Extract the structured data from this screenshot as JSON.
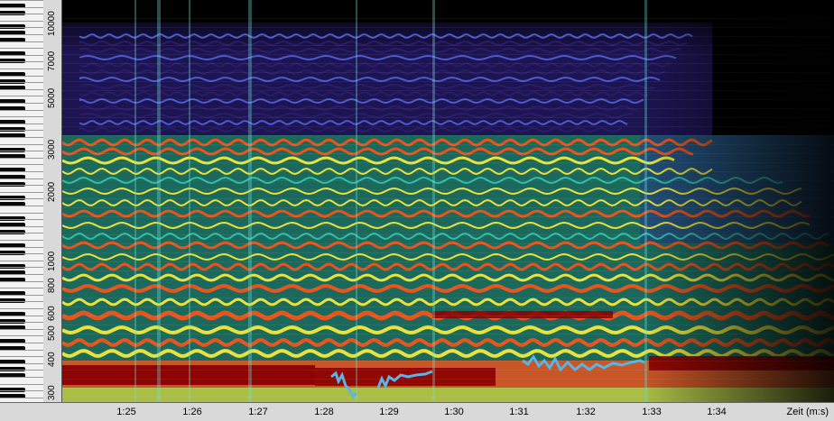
{
  "frequency_axis": {
    "ticks": [
      "300",
      "400",
      "500",
      "600",
      "800",
      "1000",
      "2000",
      "3000",
      "5000",
      "7000",
      "10000"
    ]
  },
  "time_axis": {
    "ticks": [
      "1:25",
      "1:26",
      "1:27",
      "1:28",
      "1:29",
      "1:30",
      "1:31",
      "1:32",
      "1:33",
      "1:34"
    ],
    "title": "Zeit (m:s)"
  },
  "colors": {
    "background": "#000000",
    "low": "#2a1c6b",
    "mid": "#2fbfa8",
    "mid_high": "#e8e23c",
    "high": "#e8541c",
    "peak": "#8b0000",
    "pitch_trace": "#5ab4e6"
  }
}
